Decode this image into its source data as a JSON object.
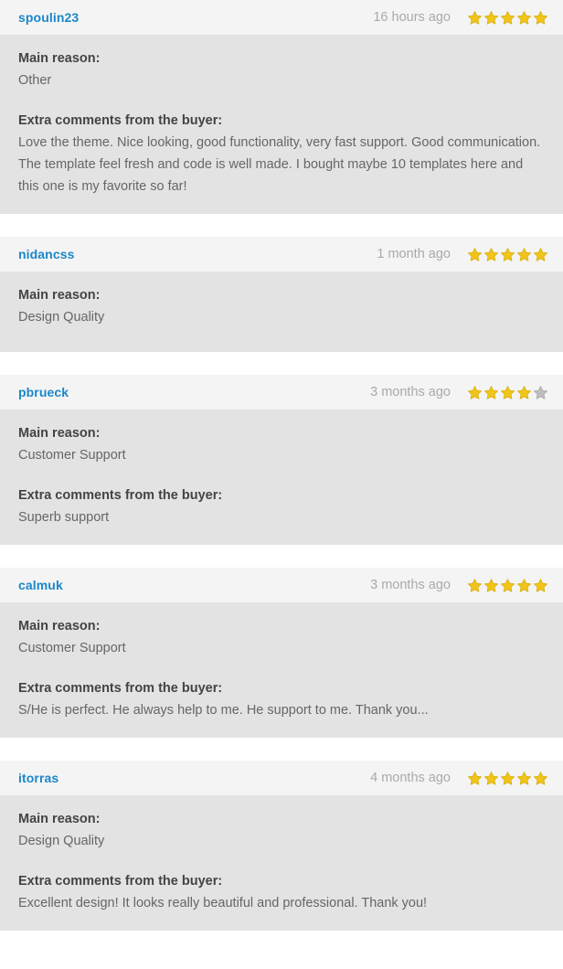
{
  "colors": {
    "star_filled": "#f0c419",
    "star_empty": "#bdbdbd",
    "username_link": "#1b87c9",
    "header_bg": "#f4f4f4",
    "body_bg": "#e3e3e3",
    "label_text": "#444444",
    "value_text": "#666666",
    "time_text": "#aaaaaa"
  },
  "labels": {
    "main_reason": "Main reason:",
    "extra_comments": "Extra comments from the buyer:"
  },
  "icons": {
    "star": "star-icon"
  },
  "reviews": [
    {
      "username": "spoulin23",
      "time": "16 hours ago",
      "rating": 5,
      "max_rating": 5,
      "main_reason_label": "Main reason:",
      "main_reason": "Other",
      "comments_label": "Extra comments from the buyer:",
      "comments": "Love the theme. Nice looking, good functionality, very fast support. Good communication. The template feel fresh and code is well made. I bought maybe 10 templates here and this one is my favorite so far!",
      "has_comments": true
    },
    {
      "username": "nidancss",
      "time": "1 month ago",
      "rating": 5,
      "max_rating": 5,
      "main_reason_label": "Main reason:",
      "main_reason": "Design Quality",
      "comments_label": "Extra comments from the buyer:",
      "comments": "",
      "has_comments": false
    },
    {
      "username": "pbrueck",
      "time": "3 months ago",
      "rating": 4,
      "max_rating": 5,
      "main_reason_label": "Main reason:",
      "main_reason": "Customer Support",
      "comments_label": "Extra comments from the buyer:",
      "comments": "Superb support",
      "has_comments": true
    },
    {
      "username": "calmuk",
      "time": "3 months ago",
      "rating": 5,
      "max_rating": 5,
      "main_reason_label": "Main reason:",
      "main_reason": "Customer Support",
      "comments_label": "Extra comments from the buyer:",
      "comments": "S/He is perfect. He always help to me. He support to me. Thank you...",
      "has_comments": true
    },
    {
      "username": "itorras",
      "time": "4 months ago",
      "rating": 5,
      "max_rating": 5,
      "main_reason_label": "Main reason:",
      "main_reason": "Design Quality",
      "comments_label": "Extra comments from the buyer:",
      "comments": "Excellent design! It looks really beautiful and professional. Thank you!",
      "has_comments": true
    }
  ]
}
